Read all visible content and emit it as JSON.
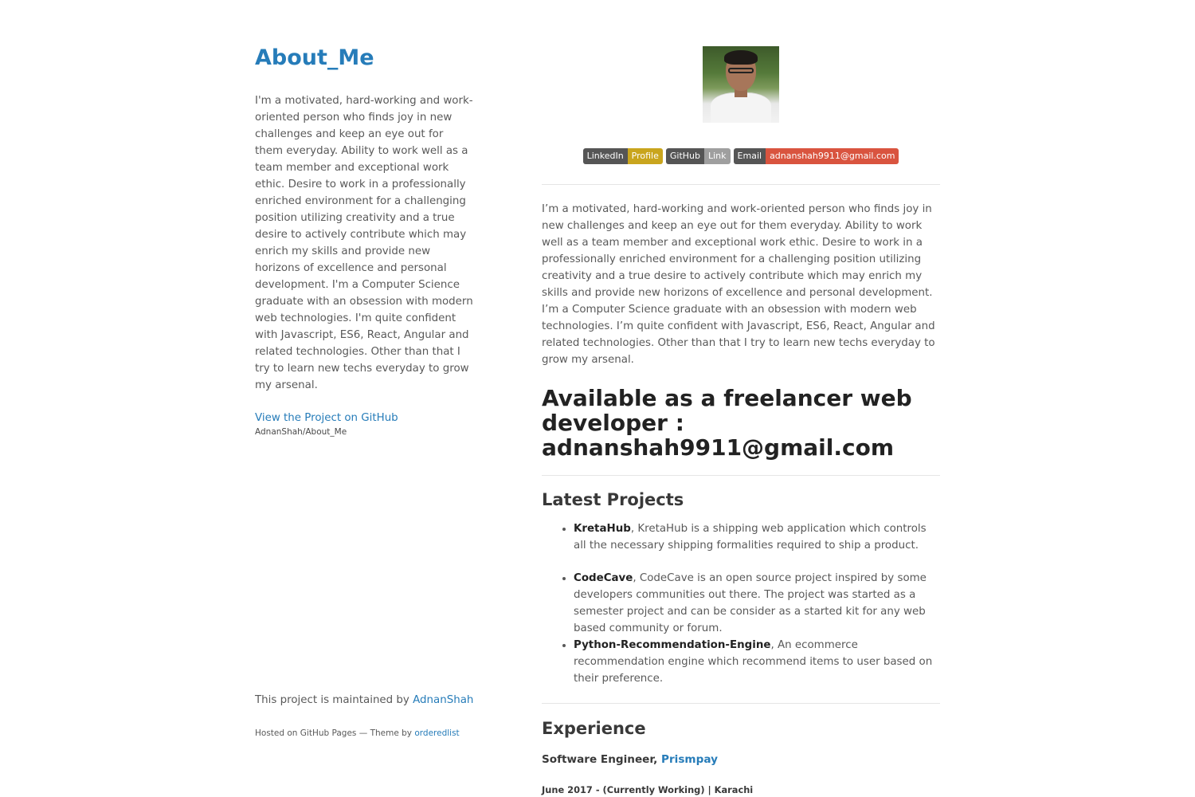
{
  "sidebar": {
    "title": "About_Me",
    "description": "I'm a motivated, hard-working and work-oriented person who finds joy in new challenges and keep an eye out for them everyday. Ability to work well as a team member and exceptional work ethic. Desire to work in a professionally enriched environment for a challenging position utilizing creativity and a true desire to actively contribute which may enrich my skills and provide new horizons of excellence and personal development. I'm a Computer Science graduate with an obsession with modern web technologies. I'm quite confident with Javascript, ES6, React, Angular and related technologies. Other than that I try to learn new techs everyday to grow my arsenal.",
    "view_link": "View the Project on GitHub",
    "repo_name": "AdnanShah/About_Me",
    "maintained_prefix": "This project is maintained by",
    "maintainer": "AdnanShah",
    "hosted_prefix": "Hosted on GitHub Pages — Theme by",
    "theme_author": "orderedlist"
  },
  "badges": [
    {
      "label": "LinkedIn",
      "message": "Profile",
      "color": "#c9a51d"
    },
    {
      "label": "GitHub",
      "message": "Link",
      "color": "#9f9f9f"
    },
    {
      "label": "Email",
      "message": "adnanshah9911@gmail.com",
      "color": "#d9543f"
    }
  ],
  "main": {
    "intro": "I’m a motivated, hard-working and work-oriented person who finds joy in new challenges and keep an eye out for them everyday. Ability to work well as a team member and exceptional work ethic. Desire to work in a professionally enriched environment for a challenging position utilizing creativity and a true desire to actively contribute which may enrich my skills and provide new horizons of excellence and personal development. I’m a Computer Science graduate with an obsession with modern web technologies. I’m quite confident with Javascript, ES6, React, Angular and related technologies. Other than that I try to learn new techs everyday to grow my arsenal.",
    "freelance_heading": "Available as a freelancer web developer : adnanshah9911@gmail.com",
    "projects_heading": "Latest Projects",
    "projects": [
      {
        "name": "KretaHub",
        "description": ", KretaHub is a shipping web application which controls all the necessary shipping formalities required to ship a product."
      },
      {
        "name": "CodeCave",
        "description": ", CodeCave is an open source project inspired by some developers communities out there. The project was started as a semester project and can be consider as a started kit for any web based community or forum."
      },
      {
        "name": "Python-Recommendation-Engine",
        "description": ", An ecommerce recommendation engine which recommend items to user based on their preference."
      }
    ],
    "experience_heading": "Experience",
    "job_title": "Software Engineer,",
    "job_company": "Prismpay",
    "job_date": "June 2017 - (Currently Working) | Karachi"
  },
  "colors": {
    "link": "#267CB9",
    "text": "#595959",
    "heading": "#222222"
  }
}
